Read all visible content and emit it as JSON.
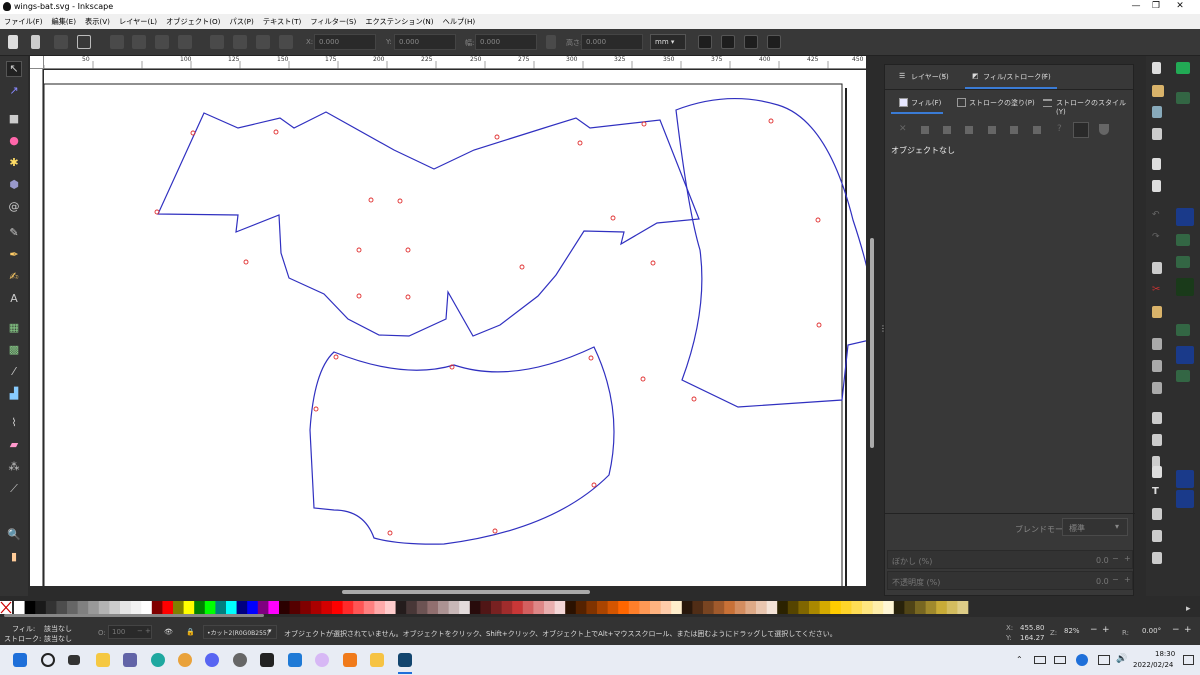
{
  "window": {
    "title": "wings-bat.svg - Inkscape"
  },
  "menu": [
    "ファイル(F)",
    "編集(E)",
    "表示(V)",
    "レイヤー(L)",
    "オブジェクト(O)",
    "パス(P)",
    "テキスト(T)",
    "フィルター(S)",
    "エクステンション(N)",
    "ヘルプ(H)"
  ],
  "toolbar": {
    "x_label": "X:",
    "x_value": "0.000",
    "y_label": "Y:",
    "y_value": "0.000",
    "w_label": "幅:",
    "w_value": "0.000",
    "h_label": "高さ:",
    "h_value": "0.000",
    "unit": "mm"
  },
  "ruler": {
    "labels": [
      "50",
      "100",
      "125",
      "150",
      "175",
      "200",
      "225",
      "250",
      "275",
      "300",
      "325",
      "350",
      "375",
      "400",
      "425",
      "450"
    ]
  },
  "dock": {
    "tab_layers": "レイヤー(S)",
    "tab_fillstroke": "フィル/ストローク(F)",
    "sub_fill": "フィル(F)",
    "sub_stroke_paint": "ストロークの塗り(P)",
    "sub_stroke_style": "ストロークのスタイル(Y)",
    "no_object": "オブジェクトなし",
    "blend_label": "ブレンドモード:",
    "blend_value": "標準",
    "blur_label": "ぼかし (%)",
    "blur_value": "0.0",
    "opacity_label": "不透明度 (%)",
    "opacity_value": "0.0"
  },
  "status": {
    "fill_label": "フィル:",
    "fill_value": "該当なし",
    "stroke_label": "ストローク:",
    "stroke_value": "該当なし",
    "o_label": "O:",
    "o_value": "100",
    "layer_name": "•カット2(R0G0B255)",
    "message": "オブジェクトが選択されていません。オブジェクトをクリック、Shift+クリック、オブジェクト上でAlt+マウススクロール、または囲むようにドラッグして選択してください。",
    "x_label": "X:",
    "x_value": "455.80",
    "y_label": "Y:",
    "y_value": "164.27",
    "zoom_label": "Z:",
    "zoom_value": "82%",
    "rot_label": "R:",
    "rot_value": "0.00°"
  },
  "taskbar": {
    "time": "18:30",
    "date": "2022/02/24"
  },
  "colors": {
    "path_stroke": "#3030c0",
    "node": "#e03030"
  }
}
